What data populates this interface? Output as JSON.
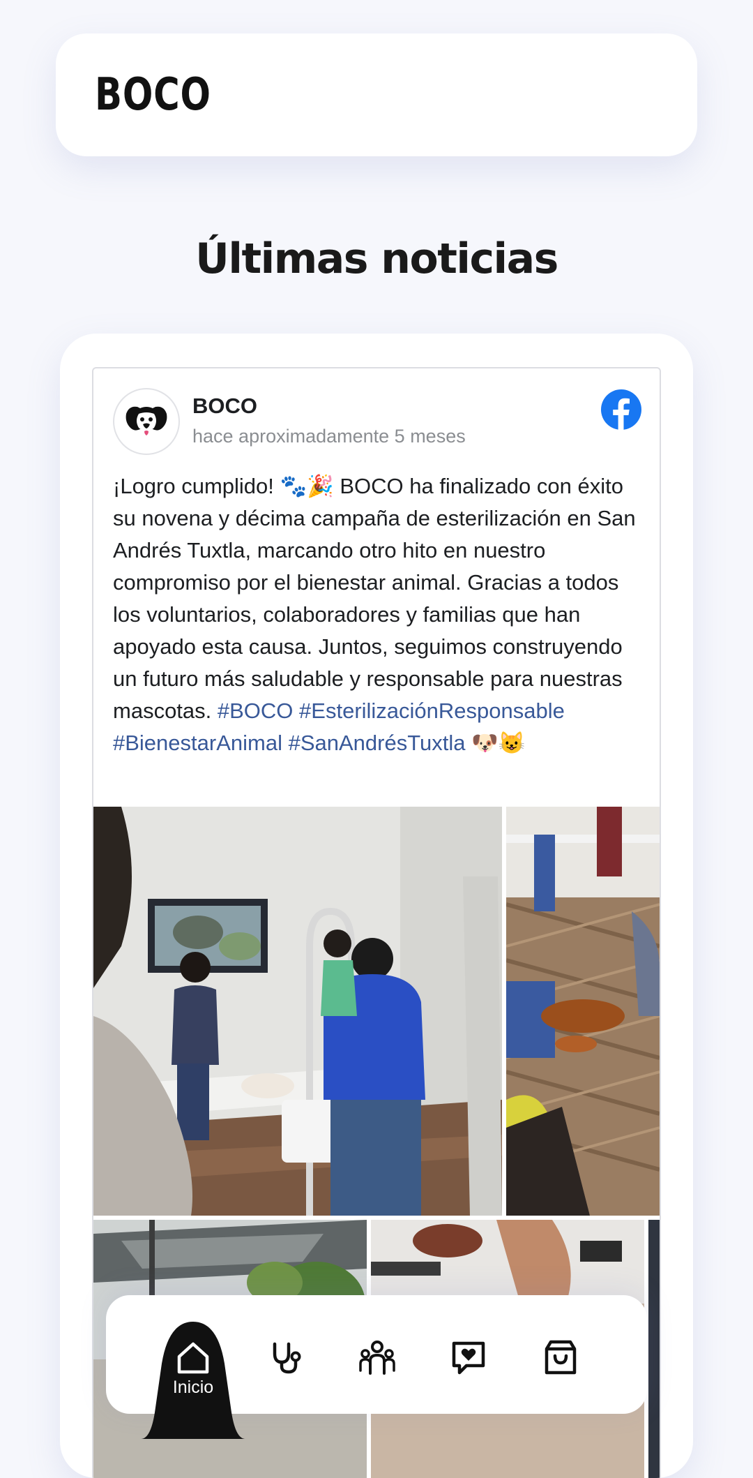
{
  "header": {
    "brand": "BOCO"
  },
  "section": {
    "title": "Últimas noticias"
  },
  "post": {
    "author": "BOCO",
    "time": "hace aproximadamente 5 meses",
    "text_part1": "¡Logro cumplido! 🐾🎉 BOCO ha finalizado con éxito su novena y décima campaña de esterilización en San Andrés Tuxtla, marcando otro hito en nuestro compromiso por el bienestar animal. Gracias a todos los voluntarios, colaboradores y familias que han apoyado esta causa. Juntos, seguimos construyendo un futuro más saludable y responsable para nuestras mascotas. ",
    "hashtags": [
      "#BOCO",
      "#EsterilizaciónResponsable",
      "#BienestarAnimal",
      "#SanAndrésTuxtla"
    ],
    "emoji_end": "🐶😺",
    "photo_count": 5
  },
  "nav": {
    "items": [
      {
        "icon": "home-icon",
        "label": "Inicio",
        "active": true
      },
      {
        "icon": "stethoscope-icon"
      },
      {
        "icon": "community-icon"
      },
      {
        "icon": "heart-message-icon"
      },
      {
        "icon": "shopping-bag-icon"
      }
    ]
  },
  "colors": {
    "background": "#f6f7fc",
    "card": "#ffffff",
    "facebook": "#1877f2",
    "hashtag": "#385898",
    "nav_active": "#111111"
  }
}
